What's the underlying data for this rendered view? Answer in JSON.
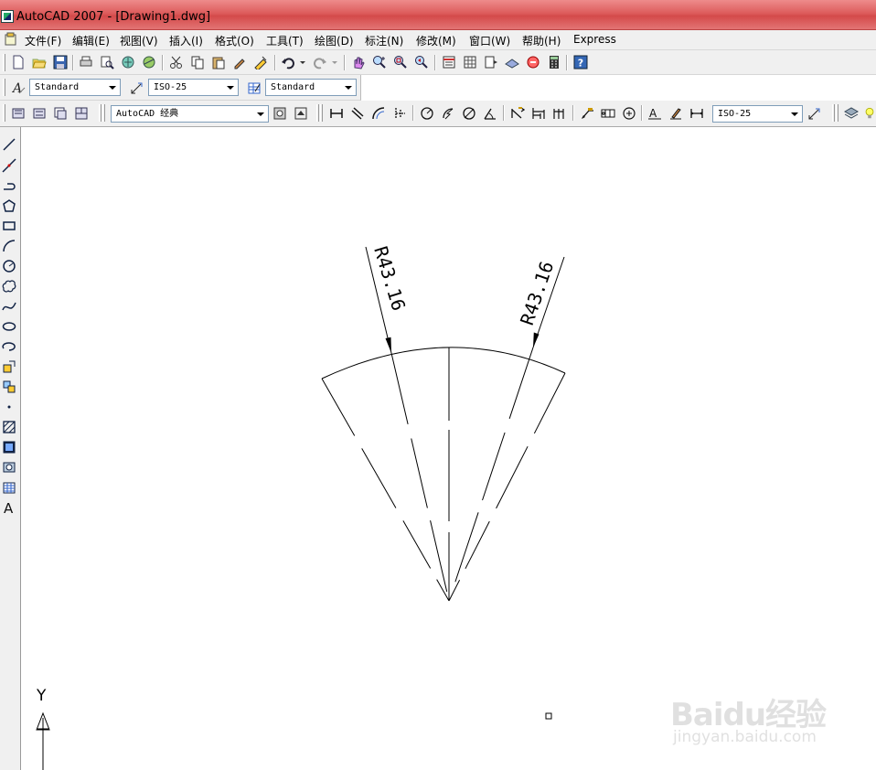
{
  "window": {
    "title": "AutoCAD 2007 - [Drawing1.dwg]"
  },
  "menubar": {
    "items": [
      {
        "label": "文件(F)"
      },
      {
        "label": "编辑(E)"
      },
      {
        "label": "视图(V)"
      },
      {
        "label": "插入(I)"
      },
      {
        "label": "格式(O)"
      },
      {
        "label": "工具(T)"
      },
      {
        "label": "绘图(D)"
      },
      {
        "label": "标注(N)"
      },
      {
        "label": "修改(M)"
      },
      {
        "label": "窗口(W)"
      },
      {
        "label": "帮助(H)"
      },
      {
        "label": "Express"
      }
    ]
  },
  "styles_toolbar": {
    "text_style": "Standard",
    "dim_style": "ISO-25",
    "table_style": "Standard"
  },
  "workspace_toolbar": {
    "workspace": "AutoCAD 经典",
    "dim_style": "ISO-25"
  },
  "drawing": {
    "dimension_left": "R43.16",
    "dimension_right": "R43.16",
    "ucs_y_label": "Y"
  },
  "watermark": {
    "main": "Baidu经验",
    "sub": "jingyan.baidu.com"
  },
  "colors": {
    "titlebar": "#dd5c5c",
    "toolbar": "#f0f0f0",
    "canvas": "#ffffff"
  }
}
